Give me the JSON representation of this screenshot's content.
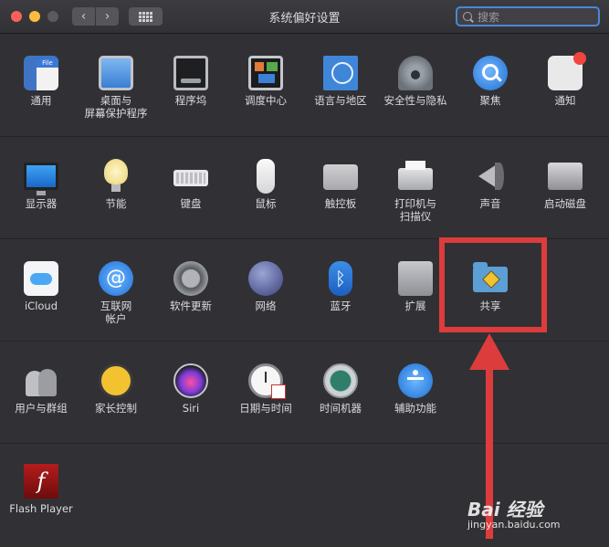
{
  "window": {
    "title": "系统偏好设置"
  },
  "search": {
    "placeholder": "搜索"
  },
  "rows": [
    [
      {
        "name": "general",
        "label": "通用",
        "icon": "general-icon"
      },
      {
        "name": "desktop",
        "label": "桌面与\n屏幕保护程序",
        "icon": "desktop-screensaver-icon"
      },
      {
        "name": "dock",
        "label": "程序坞",
        "icon": "dock-icon"
      },
      {
        "name": "mission",
        "label": "调度中心",
        "icon": "mission-control-icon"
      },
      {
        "name": "language",
        "label": "语言与地区",
        "icon": "language-region-icon"
      },
      {
        "name": "security",
        "label": "安全性与隐私",
        "icon": "security-privacy-icon"
      },
      {
        "name": "spotlight",
        "label": "聚焦",
        "icon": "spotlight-icon"
      },
      {
        "name": "notifications",
        "label": "通知",
        "icon": "notifications-icon"
      }
    ],
    [
      {
        "name": "displays",
        "label": "显示器",
        "icon": "displays-icon"
      },
      {
        "name": "energy",
        "label": "节能",
        "icon": "energy-saver-icon"
      },
      {
        "name": "keyboard",
        "label": "键盘",
        "icon": "keyboard-icon"
      },
      {
        "name": "mouse",
        "label": "鼠标",
        "icon": "mouse-icon"
      },
      {
        "name": "trackpad",
        "label": "触控板",
        "icon": "trackpad-icon"
      },
      {
        "name": "printers",
        "label": "打印机与\n扫描仪",
        "icon": "printer-scanner-icon"
      },
      {
        "name": "sound",
        "label": "声音",
        "icon": "sound-icon"
      },
      {
        "name": "startup",
        "label": "启动磁盘",
        "icon": "startup-disk-icon"
      }
    ],
    [
      {
        "name": "icloud",
        "label": "iCloud",
        "icon": "icloud-icon"
      },
      {
        "name": "internet",
        "label": "互联网\n帐户",
        "icon": "internet-accounts-icon"
      },
      {
        "name": "swupdate",
        "label": "软件更新",
        "icon": "software-update-icon"
      },
      {
        "name": "network",
        "label": "网络",
        "icon": "network-icon"
      },
      {
        "name": "bluetooth",
        "label": "蓝牙",
        "icon": "bluetooth-icon"
      },
      {
        "name": "extensions",
        "label": "扩展",
        "icon": "extensions-icon"
      },
      {
        "name": "sharing",
        "label": "共享",
        "icon": "sharing-icon"
      }
    ],
    [
      {
        "name": "users",
        "label": "用户与群组",
        "icon": "users-groups-icon"
      },
      {
        "name": "parental",
        "label": "家长控制",
        "icon": "parental-controls-icon"
      },
      {
        "name": "siri",
        "label": "Siri",
        "icon": "siri-icon"
      },
      {
        "name": "datetime",
        "label": "日期与时间",
        "icon": "date-time-icon"
      },
      {
        "name": "timemachine",
        "label": "时间机器",
        "icon": "time-machine-icon"
      },
      {
        "name": "accessibility",
        "label": "辅助功能",
        "icon": "accessibility-icon"
      }
    ],
    [
      {
        "name": "flash",
        "label": "Flash Player",
        "icon": "flash-player-icon"
      }
    ]
  ],
  "colors": {
    "annotation": "#dd3c3c",
    "accent": "#4a87d6"
  },
  "watermark": {
    "logo": "Bai 经验",
    "url": "jingyan.baidu.com"
  }
}
